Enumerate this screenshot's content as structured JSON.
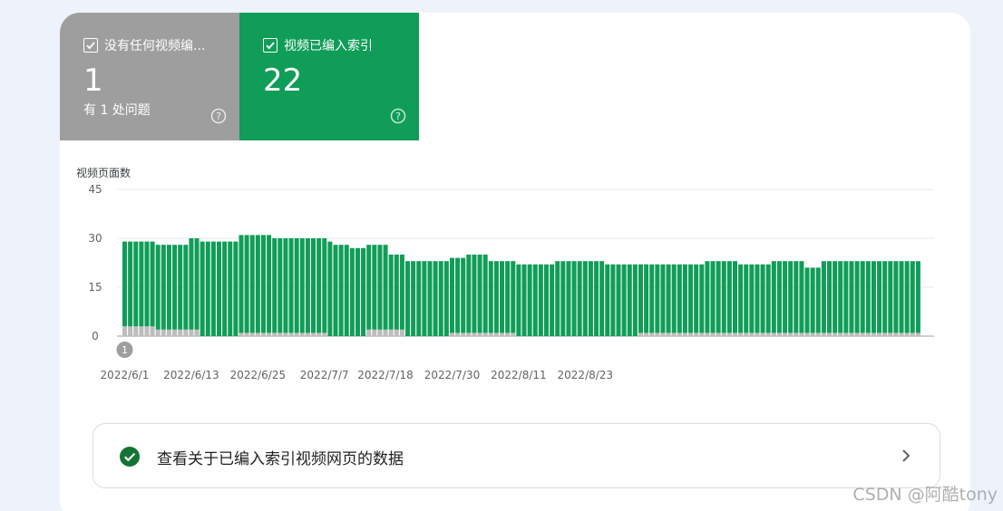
{
  "tiles": [
    {
      "label": "没有任何视频编...",
      "value": "1",
      "sub": "有 1 处问题"
    },
    {
      "label": "视频已编入索引",
      "value": "22",
      "sub": ""
    }
  ],
  "chart_data": {
    "type": "bar",
    "ylabel": "视频页面数",
    "ylim": [
      0,
      45
    ],
    "yticks": [
      0,
      15,
      30,
      45
    ],
    "xtick_labels": [
      "2022/6/1",
      "2022/6/13",
      "2022/6/25",
      "2022/7/7",
      "2022/7/18",
      "2022/7/30",
      "2022/8/11",
      "2022/8/23"
    ],
    "xtick_indices": [
      0,
      12,
      24,
      36,
      47,
      59,
      71,
      83
    ],
    "annotation": {
      "index": 0,
      "text": "1"
    },
    "colors": {
      "indexed": "#109d58",
      "not_indexed": "#bdbdbd"
    },
    "series": [
      {
        "name": "视频已编入索引",
        "values": [
          26,
          26,
          26,
          26,
          26,
          26,
          26,
          26,
          26,
          26,
          26,
          26,
          28,
          28,
          29,
          29,
          29,
          29,
          29,
          29,
          29,
          30,
          30,
          30,
          30,
          30,
          30,
          29,
          29,
          29,
          29,
          29,
          29,
          29,
          29,
          29,
          29,
          29,
          28,
          28,
          28,
          27,
          27,
          27,
          26,
          26,
          26,
          26,
          23,
          23,
          23,
          23,
          23,
          23,
          23,
          23,
          23,
          23,
          23,
          23,
          23,
          23,
          24,
          24,
          24,
          24,
          22,
          22,
          22,
          22,
          22,
          22,
          22,
          22,
          22,
          22,
          22,
          22,
          23,
          23,
          23,
          23,
          23,
          23,
          23,
          23,
          23,
          22,
          22,
          22,
          22,
          22,
          22,
          21,
          21,
          21,
          21,
          21,
          21,
          21,
          21,
          21,
          21,
          21,
          21,
          22,
          22,
          22,
          22,
          22,
          22,
          21,
          21,
          21,
          21,
          21,
          21,
          22,
          22,
          22,
          22,
          22,
          22,
          20,
          20,
          20,
          22,
          22,
          22,
          22,
          22,
          22,
          22,
          22,
          22,
          22,
          22,
          22,
          22,
          22,
          22,
          22,
          22,
          22
        ]
      },
      {
        "name": "没有任何视频编入索引",
        "values": [
          3,
          3,
          3,
          3,
          3,
          3,
          2,
          2,
          2,
          2,
          2,
          2,
          2,
          2,
          0,
          0,
          0,
          0,
          0,
          0,
          0,
          1,
          1,
          1,
          1,
          1,
          1,
          1,
          1,
          1,
          1,
          1,
          1,
          1,
          1,
          1,
          1,
          0,
          0,
          0,
          0,
          0,
          0,
          0,
          2,
          2,
          2,
          2,
          2,
          2,
          2,
          0,
          0,
          0,
          0,
          0,
          0,
          0,
          0,
          1,
          1,
          1,
          1,
          1,
          1,
          1,
          1,
          1,
          1,
          1,
          1,
          0,
          0,
          0,
          0,
          0,
          0,
          0,
          0,
          0,
          0,
          0,
          0,
          0,
          0,
          0,
          0,
          0,
          0,
          0,
          0,
          0,
          0,
          1,
          1,
          1,
          1,
          1,
          1,
          1,
          1,
          1,
          1,
          1,
          1,
          1,
          1,
          1,
          1,
          1,
          1,
          1,
          1,
          1,
          1,
          1,
          1,
          1,
          1,
          1,
          1,
          1,
          1,
          1,
          1,
          1,
          1,
          1,
          1,
          1,
          1,
          1,
          1,
          1,
          1,
          1,
          1,
          1,
          1,
          1,
          1,
          1,
          1,
          1,
          1,
          1,
          1
        ]
      }
    ]
  },
  "link_row": {
    "text": "查看关于已编入索引视频网页的数据"
  },
  "watermark": "CSDN @阿酷tony"
}
